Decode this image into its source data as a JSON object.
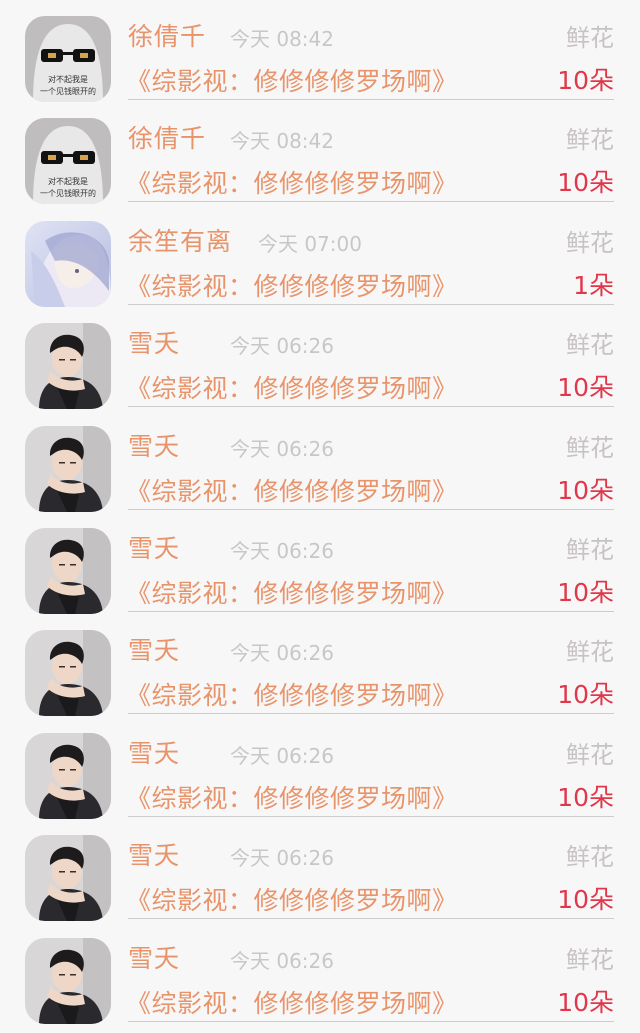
{
  "gift_records": [
    {
      "avatar": "ghost-sunglasses",
      "avatar_caption": "对不起我是\n一个见钱眼开的",
      "name": "徐倩千",
      "time": "今天 08:42",
      "gift_type": "鲜花",
      "work_title": "《综影视：修修修修罗场啊》",
      "count": "10朵"
    },
    {
      "avatar": "ghost-sunglasses",
      "avatar_caption": "对不起我是\n一个见钱眼开的",
      "name": "徐倩千",
      "time": "今天 08:42",
      "gift_type": "鲜花",
      "work_title": "《综影视：修修修修罗场啊》",
      "count": "10朵"
    },
    {
      "avatar": "anime-girl",
      "name": "余笙有离",
      "time": "今天 07:00",
      "gift_type": "鲜花",
      "work_title": "《综影视：修修修修罗场啊》",
      "count": "1朵"
    },
    {
      "avatar": "man-portrait",
      "name": "雪夭",
      "time": "今天 06:26",
      "gift_type": "鲜花",
      "work_title": "《综影视：修修修修罗场啊》",
      "count": "10朵"
    },
    {
      "avatar": "man-portrait",
      "name": "雪夭",
      "time": "今天 06:26",
      "gift_type": "鲜花",
      "work_title": "《综影视：修修修修罗场啊》",
      "count": "10朵"
    },
    {
      "avatar": "man-portrait",
      "name": "雪夭",
      "time": "今天 06:26",
      "gift_type": "鲜花",
      "work_title": "《综影视：修修修修罗场啊》",
      "count": "10朵"
    },
    {
      "avatar": "man-portrait",
      "name": "雪夭",
      "time": "今天 06:26",
      "gift_type": "鲜花",
      "work_title": "《综影视：修修修修罗场啊》",
      "count": "10朵"
    },
    {
      "avatar": "man-portrait",
      "name": "雪夭",
      "time": "今天 06:26",
      "gift_type": "鲜花",
      "work_title": "《综影视：修修修修罗场啊》",
      "count": "10朵"
    },
    {
      "avatar": "man-portrait",
      "name": "雪夭",
      "time": "今天 06:26",
      "gift_type": "鲜花",
      "work_title": "《综影视：修修修修罗场啊》",
      "count": "10朵"
    },
    {
      "avatar": "man-portrait",
      "name": "雪夭",
      "time": "今天 06:26",
      "gift_type": "鲜花",
      "work_title": "《综影视：修修修修罗场啊》",
      "count": "10朵"
    }
  ],
  "colors": {
    "background": "#f8f7f8",
    "name_orange": "#e8946a",
    "muted_gray": "#c7c3c4",
    "count_red": "#e0384b",
    "divider": "#cfcccd"
  }
}
